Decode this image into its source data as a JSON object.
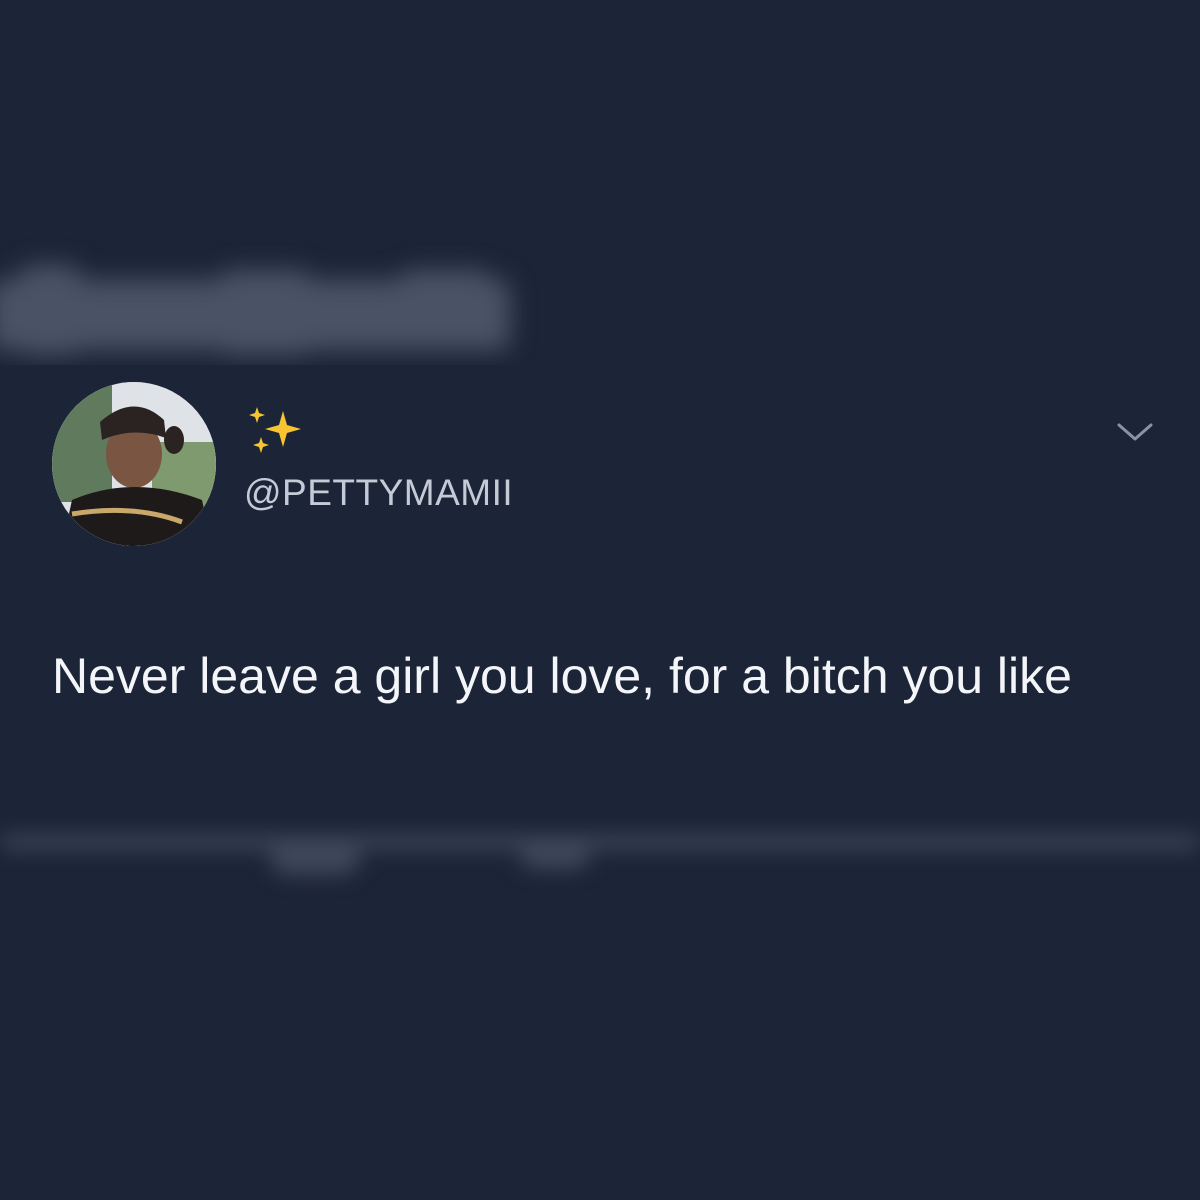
{
  "colors": {
    "background": "#1c2537",
    "tweet_text": "#f3f5f8",
    "handle_text": "#c5cbd6",
    "caret": "#8a93a5",
    "sparkle": "#f7c531"
  },
  "tweet": {
    "display_name_icon": "sparkles-icon",
    "handle": "@PETTYMAMII",
    "text": "Never leave a girl you love, for a bitch you like",
    "menu_icon": "chevron-down-icon",
    "avatar_icon": "profile-avatar"
  }
}
